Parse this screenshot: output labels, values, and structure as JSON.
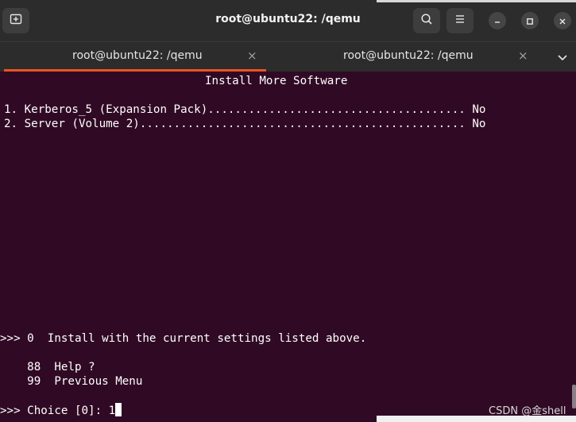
{
  "window": {
    "title": "root@ubuntu22: /qemu"
  },
  "icons": {
    "new_tab": "new-tab-icon",
    "search": "search-icon",
    "menu": "hamburger-menu-icon",
    "minimize": "minimize-icon",
    "maximize": "maximize-icon",
    "close": "close-icon",
    "tab_list": "chevron-down-icon"
  },
  "tabs": [
    {
      "label": "root@ubuntu22: /qemu",
      "close": "×",
      "active": true
    },
    {
      "label": "root@ubuntu22: /qemu",
      "close": "×",
      "active": false
    }
  ],
  "colors": {
    "terminal_bg": "#300a24",
    "titlebar_bg": "#2c2c2c",
    "accent": "#e95420",
    "text": "#ffffff"
  },
  "terminal": {
    "heading": "Install More Software",
    "items": [
      {
        "text": "1. Kerberos_5 (Expansion Pack)...................................... No"
      },
      {
        "text": "2. Server (Volume 2)................................................ No"
      }
    ],
    "install_line": ">>> 0  Install with the current settings listed above.",
    "options": [
      {
        "text": "    88  Help ?"
      },
      {
        "text": "    99  Previous Menu"
      }
    ],
    "prompt": ">>> Choice [0]: ",
    "input_value": "1"
  },
  "watermark": "CSDN @金shell"
}
